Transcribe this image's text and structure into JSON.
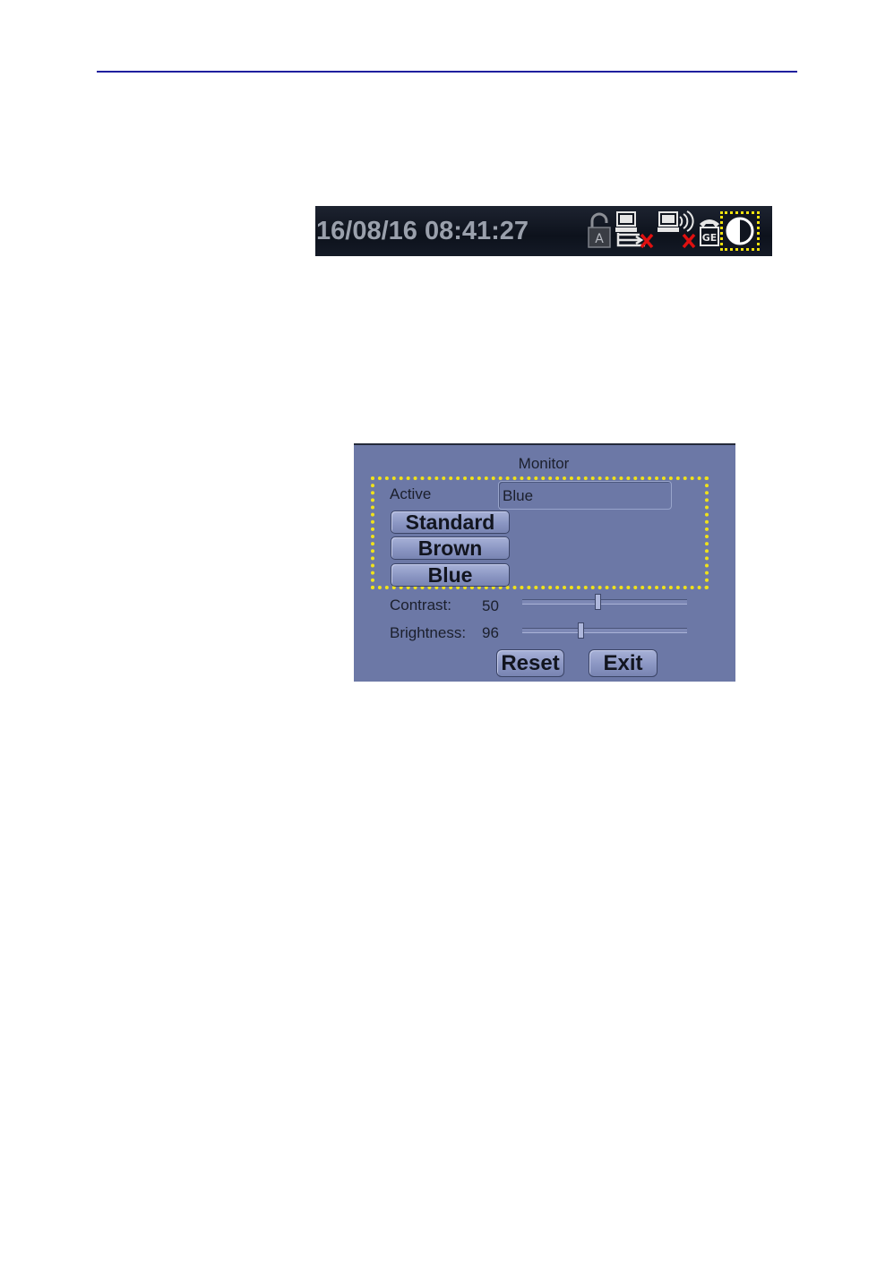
{
  "status_bar": {
    "datetime": "16/08/16 08:41:27",
    "icons": [
      "lock-icon",
      "network-disconnected-icon",
      "wireless-disconnected-icon",
      "ge-phone-icon",
      "contrast-icon"
    ],
    "colors": {
      "background": "#10151f",
      "text": "#9aa0ac",
      "highlight": "#f3e20e",
      "error": "#e01010"
    }
  },
  "monitor_dialog": {
    "title": "Monitor",
    "active_label": "Active",
    "active_value": "Blue",
    "presets": [
      "Standard",
      "Brown",
      "Blue"
    ],
    "contrast": {
      "label": "Contrast:",
      "value": "50",
      "level": 0.45
    },
    "brightness": {
      "label": "Brightness:",
      "value": "96",
      "level": 0.35
    },
    "reset_label": "Reset",
    "exit_label": "Exit",
    "colors": {
      "background": "#6c78a6",
      "highlight": "#f0e21a"
    }
  }
}
